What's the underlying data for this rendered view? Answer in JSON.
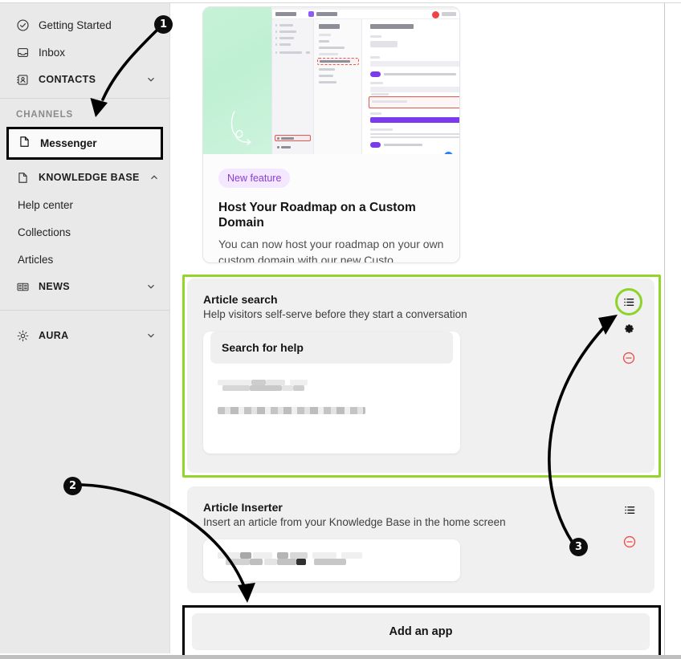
{
  "sidebar": {
    "items": [
      {
        "label": "Getting Started",
        "icon": "check-circle-icon",
        "type": "link",
        "chevron": false
      },
      {
        "label": "Inbox",
        "icon": "inbox-icon",
        "type": "link",
        "chevron": false
      },
      {
        "label": "CONTACTS",
        "icon": "contacts-icon",
        "type": "group",
        "chevron": "down"
      }
    ],
    "channels_label": "CHANNELS",
    "messenger": {
      "label": "Messenger",
      "icon": "messenger-icon",
      "selected": true
    },
    "knowledge_base": {
      "label": "KNOWLEDGE BASE",
      "icon": "book-page-icon",
      "chevron": "up"
    },
    "kb_links": [
      "Help center",
      "Collections",
      "Articles"
    ],
    "news": {
      "label": "NEWS",
      "icon": "news-icon",
      "chevron": "down"
    },
    "aura": {
      "label": "AURA",
      "icon": "gear-icon",
      "chevron": "down"
    }
  },
  "news_card": {
    "badge": "New feature",
    "title": "Host Your Roadmap on a Custom Domain",
    "description": "You can now host your roadmap on your own custom domain with our new Custo...",
    "thumbnail_alt": "feedbackwhip-settings-screenshot"
  },
  "apps": [
    {
      "title": "Article search",
      "subtitle": "Help visitors self-serve before they start a conversation",
      "preview_search_label": "Search for help",
      "highlighted": true,
      "actions": [
        {
          "name": "reorder-icon",
          "highlighted": true
        },
        {
          "name": "gear-icon",
          "highlighted": false
        },
        {
          "name": "remove-icon",
          "highlighted": false
        }
      ]
    },
    {
      "title": "Article Inserter",
      "subtitle": "Insert an article from your Knowledge Base in the home screen",
      "highlighted": false,
      "actions": [
        {
          "name": "reorder-icon",
          "highlighted": false
        },
        {
          "name": "remove-icon",
          "highlighted": false
        }
      ]
    }
  ],
  "add_app": {
    "label": "Add an app"
  },
  "annotations": [
    {
      "number": "1",
      "target": "sidebar-messenger"
    },
    {
      "number": "2",
      "target": "add-an-app-button"
    },
    {
      "number": "3",
      "target": "article-search-reorder-icon"
    }
  ],
  "colors": {
    "highlight_green": "#93d52b",
    "highlight_black": "#000000",
    "badge_purple_bg": "#f3e8ff",
    "badge_purple_text": "#8b3dd6",
    "remove_red": "#ef4444"
  }
}
